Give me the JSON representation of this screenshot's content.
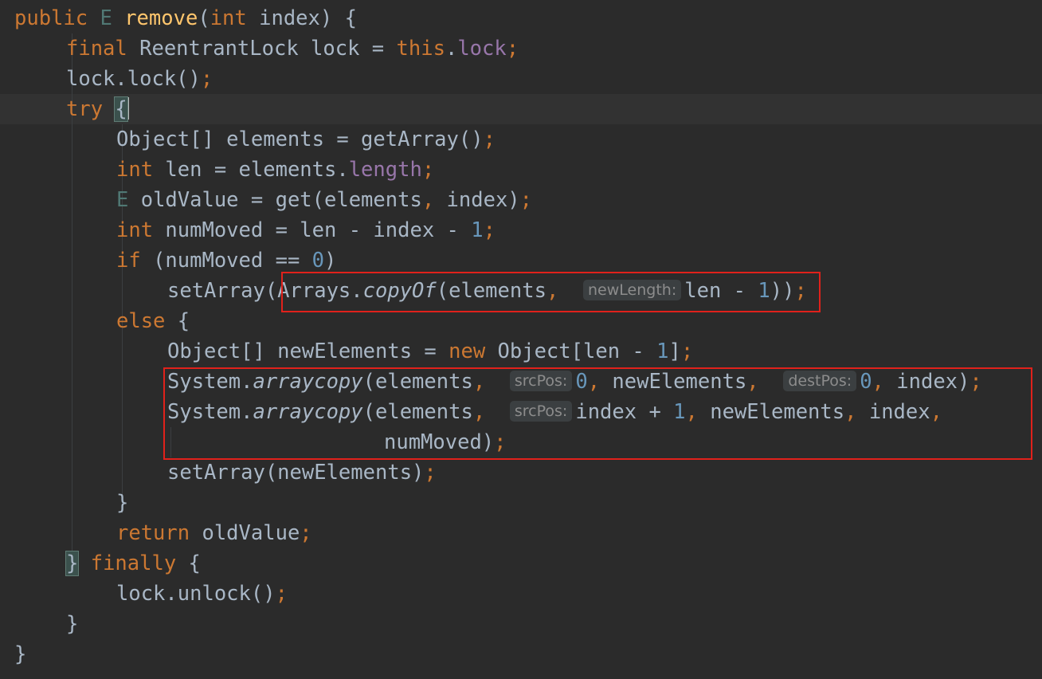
{
  "code": {
    "l1": {
      "public": "public",
      "E": "E",
      "remove": "remove",
      "p1": "(",
      "int": "int",
      "idx": "index",
      "p2": ") {"
    },
    "l2": {
      "final": "final",
      "t": " ReentrantLock lock = ",
      "this": "this",
      "dot": ".",
      "lock": "lock",
      "semi": ";"
    },
    "l3": {
      "t": "lock.lock()",
      "semi": ";"
    },
    "l4": {
      "try": "try",
      "brace": "{"
    },
    "l5": {
      "t": "Object[] elements = getArray()",
      "semi": ";"
    },
    "l6": {
      "int": "int",
      "t": " len = elements.",
      "length": "length",
      "semi": ";"
    },
    "l7": {
      "E": "E",
      "t1": " oldValue = get(elements",
      "comma": ",",
      "t2": " index)",
      "semi": ";"
    },
    "l8": {
      "int": "int",
      "t": " numMoved = len - index - ",
      "one": "1",
      "semi": ";"
    },
    "l9": {
      "if": "if",
      "t": " (numMoved == ",
      "zero": "0",
      "close": ")"
    },
    "l10": {
      "t1": "setArray(Arrays.",
      "copyOf": "copyOf",
      "t2": "(elements",
      "comma": ",",
      "hint": "newLength:",
      "t3": "len - ",
      "one": "1",
      "close": "))",
      "semi": ";"
    },
    "l11": {
      "else": "else",
      "t": " {"
    },
    "l12": {
      "t1": "Object[] newElements = ",
      "new": "new",
      "t2": " Object[len - ",
      "one": "1",
      "t3": "]",
      "semi": ";"
    },
    "l13": {
      "t1": "System.",
      "arraycopy": "arraycopy",
      "t2": "(elements",
      "c1": ",",
      "hint1": "srcPos:",
      "zero1": "0",
      "c2": ",",
      "t3": " newElements",
      "c3": ",",
      "hint2": "destPos:",
      "zero2": "0",
      "c4": ",",
      "t4": " index)",
      "semi": ";"
    },
    "l14": {
      "t1": "System.",
      "arraycopy": "arraycopy",
      "t2": "(elements",
      "c1": ",",
      "hint1": "srcPos:",
      "t3": "index + ",
      "one": "1",
      "c2": ",",
      "t4": " newElements",
      "c3": ",",
      "t5": " index",
      "c4": ","
    },
    "l15": {
      "t": "numMoved)",
      "semi": ";"
    },
    "l16": {
      "t": "setArray(newElements)",
      "semi": ";"
    },
    "l17": {
      "t": "}"
    },
    "l18": {
      "return": "return",
      "t": " oldValue",
      "semi": ";"
    },
    "l19": {
      "brace": "}",
      "finally": "finally",
      "t": " {"
    },
    "l20": {
      "t": "lock.unlock()",
      "semi": ";"
    },
    "l21": {
      "t": "}"
    },
    "l22": {
      "t": "}"
    }
  },
  "colors": {
    "background": "#2b2b2b",
    "keyword": "#cc7832",
    "method": "#ffc66d",
    "field": "#9876aa",
    "number": "#6897bb",
    "highlight_box": "#e0211b"
  }
}
